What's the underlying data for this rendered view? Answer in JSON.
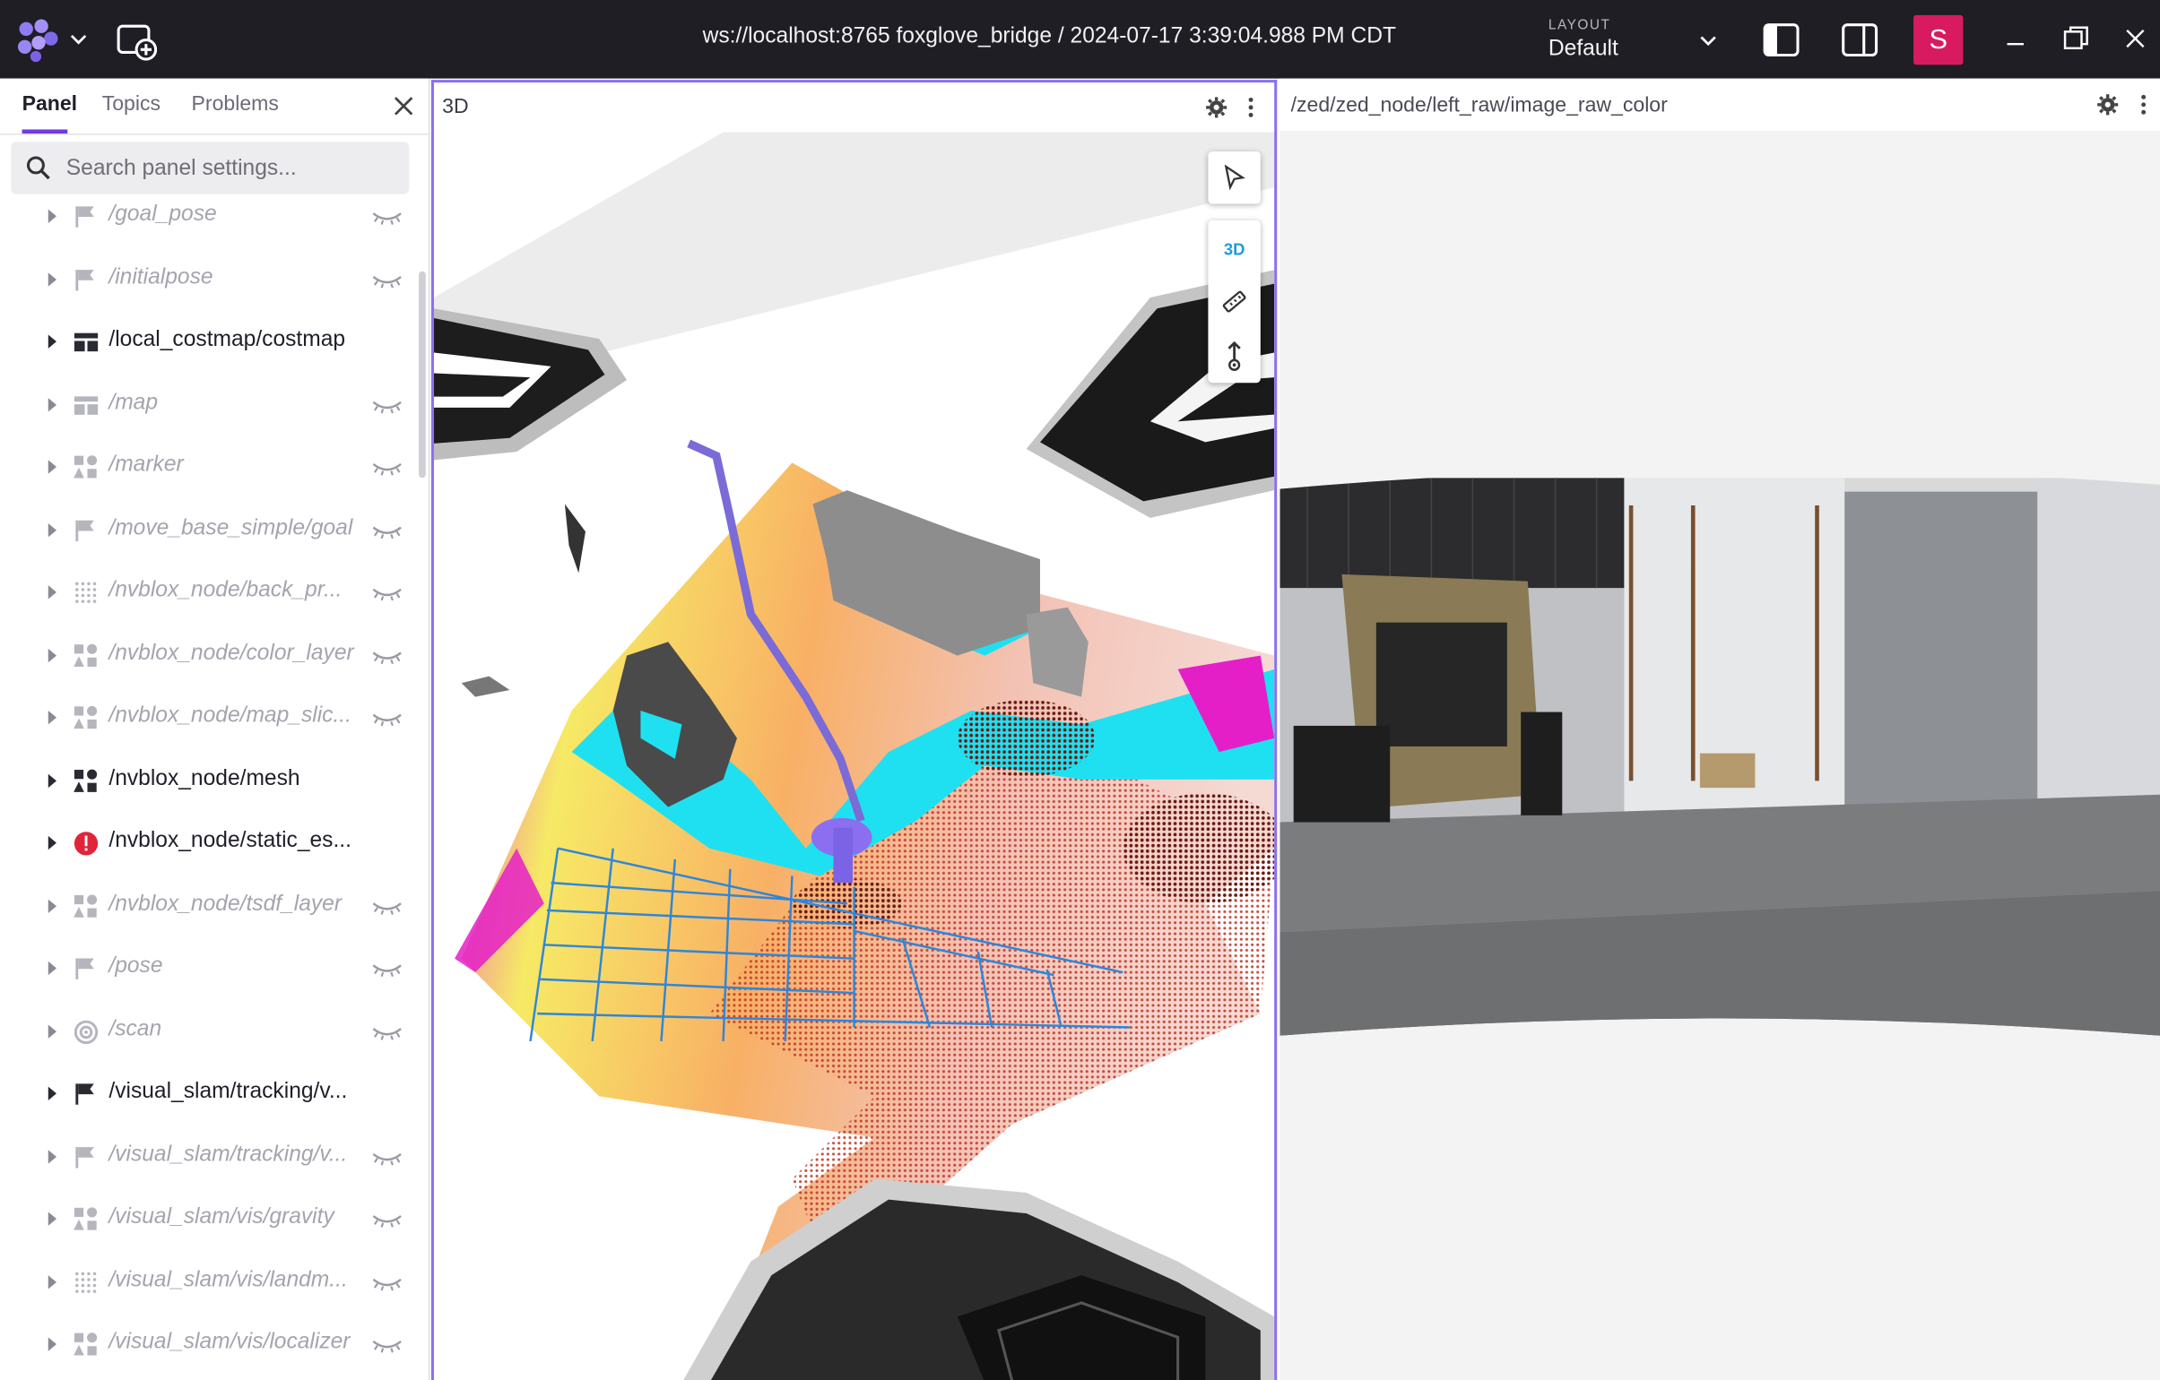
{
  "topbar": {
    "connection": "ws://localhost:8765 foxglove_bridge / 2024-07-17 3:39:04.988 PM CDT",
    "layout_caption": "LAYOUT",
    "layout_name": "Default",
    "user_initial": "S",
    "avatar_color": "#d81b60"
  },
  "sidebar": {
    "tabs": [
      {
        "label": "Panel",
        "active": true
      },
      {
        "label": "Topics",
        "active": false
      },
      {
        "label": "Problems",
        "active": false
      }
    ],
    "search_placeholder": "Search panel settings...",
    "topics": [
      {
        "label": "/goal_pose",
        "icon": "flag-icon",
        "visible": false
      },
      {
        "label": "/initialpose",
        "icon": "flag-icon",
        "visible": false
      },
      {
        "label": "/local_costmap/costmap",
        "icon": "grid-icon",
        "visible": true
      },
      {
        "label": "/map",
        "icon": "grid-icon",
        "visible": false
      },
      {
        "label": "/marker",
        "icon": "shapes-icon",
        "visible": false
      },
      {
        "label": "/move_base_simple/goal",
        "icon": "flag-icon",
        "visible": false
      },
      {
        "label": "/nvblox_node/back_pr...",
        "icon": "points-icon",
        "visible": false
      },
      {
        "label": "/nvblox_node/color_layer",
        "icon": "shapes-icon",
        "visible": false
      },
      {
        "label": "/nvblox_node/map_slic...",
        "icon": "shapes-icon",
        "visible": false
      },
      {
        "label": "/nvblox_node/mesh",
        "icon": "shapes-icon",
        "visible": true
      },
      {
        "label": "/nvblox_node/static_es...",
        "icon": "error-icon",
        "visible": true
      },
      {
        "label": "/nvblox_node/tsdf_layer",
        "icon": "shapes-icon",
        "visible": false
      },
      {
        "label": "/pose",
        "icon": "flag-icon",
        "visible": false
      },
      {
        "label": "/scan",
        "icon": "scan-icon",
        "visible": false
      },
      {
        "label": "/visual_slam/tracking/v...",
        "icon": "flag-icon",
        "visible": true
      },
      {
        "label": "/visual_slam/tracking/v...",
        "icon": "flag-icon",
        "visible": false
      },
      {
        "label": "/visual_slam/vis/gravity",
        "icon": "shapes-icon",
        "visible": false
      },
      {
        "label": "/visual_slam/vis/landm...",
        "icon": "points-icon",
        "visible": false
      },
      {
        "label": "/visual_slam/vis/localizer",
        "icon": "shapes-icon",
        "visible": false
      }
    ]
  },
  "panel_3d": {
    "title": "3D",
    "mode_label": "3D"
  },
  "panel_image": {
    "title": "/zed/zed_node/left_raw/image_raw_color"
  },
  "colors": {
    "accent": "#6f3be8",
    "panel_border": "#8b6ff0",
    "topbar_bg": "#1e1e24"
  }
}
